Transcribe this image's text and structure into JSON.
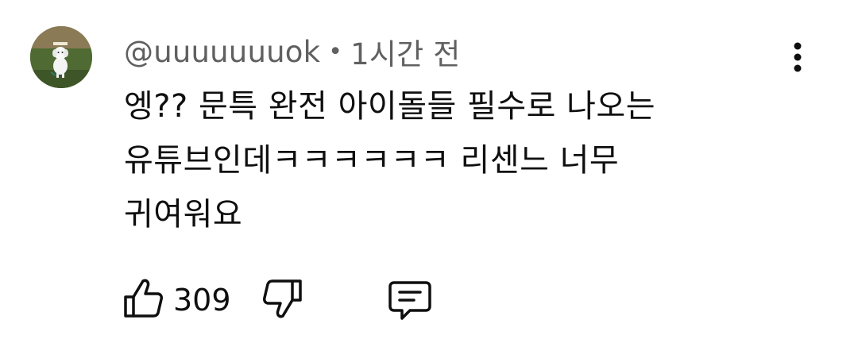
{
  "comment": {
    "author": "@uuuuuuuok",
    "separator": "•",
    "time": "1시간 전",
    "text": "엥?? 문특 완전 아이돌들 필수로 나오는\n유튜브인데ㅋㅋㅋㅋㅋㅋ 리센느 너무\n귀여워요",
    "likes": "309",
    "avatar_icon": "dog-avatar-icon",
    "menu_icon": "more-vertical-icon",
    "like_icon": "thumbs-up-icon",
    "dislike_icon": "thumbs-down-icon",
    "reply_icon": "reply-comment-icon"
  },
  "colors": {
    "meta_text": "#606060",
    "body_text": "#0f0f0f",
    "background": "#ffffff"
  }
}
